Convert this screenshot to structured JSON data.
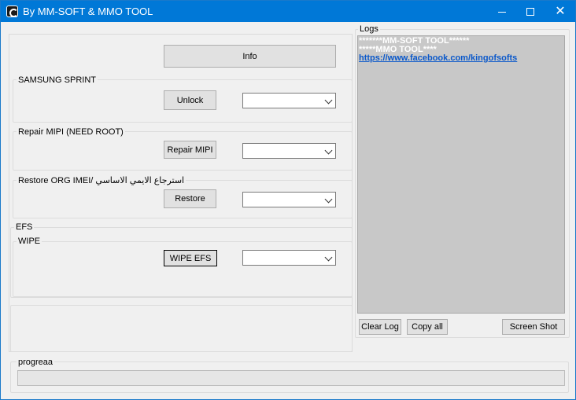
{
  "window": {
    "title": "By MM-SOFT & MMO TOOL"
  },
  "left": {
    "info_button": "Info",
    "samsung": {
      "label": "SAMSUNG SPRINT",
      "button": "Unlock",
      "combo_value": ""
    },
    "mipi": {
      "label": "Repair MIPI (NEED ROOT)",
      "button": "Repair MIPI",
      "combo_value": ""
    },
    "restore": {
      "label": "Restore ORG IMEI/ استرجاع الايمي الاساسي",
      "button": "Restore",
      "combo_value": ""
    },
    "efs": {
      "label": "EFS"
    },
    "wipe": {
      "label": "WIPE",
      "button": "WIPE EFS",
      "combo_value": ""
    }
  },
  "logs": {
    "label": "Logs",
    "lines": [
      "*******MM-SOFT TOOL******",
      "*****MMO TOOL****"
    ],
    "link": "https://www.facebook.com/kingofsofts",
    "clear_button": "Clear Log",
    "copy_button": "Copy all",
    "screenshot_button": "Screen Shot"
  },
  "progress": {
    "label": "progreaa",
    "value": 0
  }
}
